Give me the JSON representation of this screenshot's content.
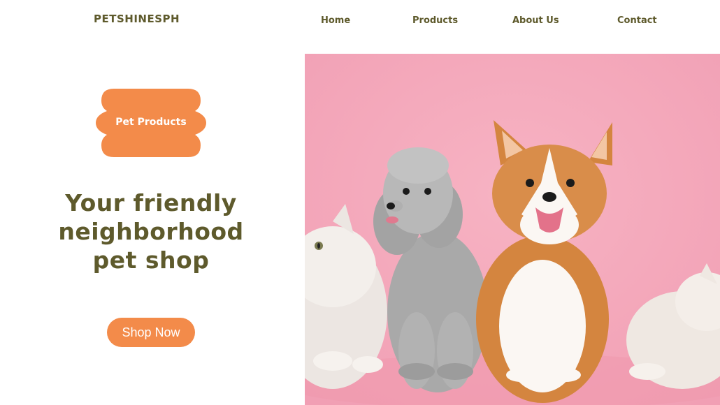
{
  "header": {
    "logo": "PETSHINESPH",
    "nav": [
      {
        "label": "Home"
      },
      {
        "label": "Products"
      },
      {
        "label": "About Us"
      },
      {
        "label": "Contact"
      }
    ]
  },
  "hero": {
    "badge_label": "Pet Products",
    "headline_lines": [
      "Your friendly",
      "neighborhood",
      "pet shop"
    ],
    "cta_label": "Shop Now",
    "image_icon": "pets-photo-icon"
  },
  "colors": {
    "brand_text": "#5e5a2c",
    "accent": "#f38b4a",
    "hero_background": "#f5a9bc",
    "page_background": "#ffffff"
  }
}
